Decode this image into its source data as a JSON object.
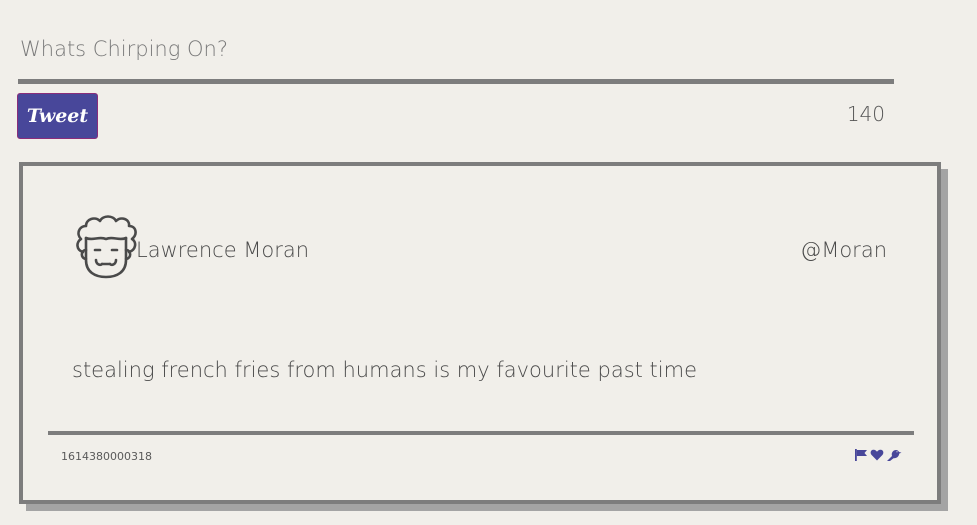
{
  "compose": {
    "placeholder": "Whats Chirping On?",
    "value": ""
  },
  "tweet_button": {
    "label": "Tweet"
  },
  "char_count": "140",
  "tweet": {
    "author_name": "Lawrence Moran",
    "handle": "@Moran",
    "text": "stealing french fries from humans is my favourite past time",
    "timestamp": "1614380000318",
    "actions": [
      "flag-icon",
      "heart-icon",
      "bird-icon"
    ]
  },
  "colors": {
    "accent": "#48479a",
    "border": "#7d7d7d",
    "background": "#f1efea"
  }
}
